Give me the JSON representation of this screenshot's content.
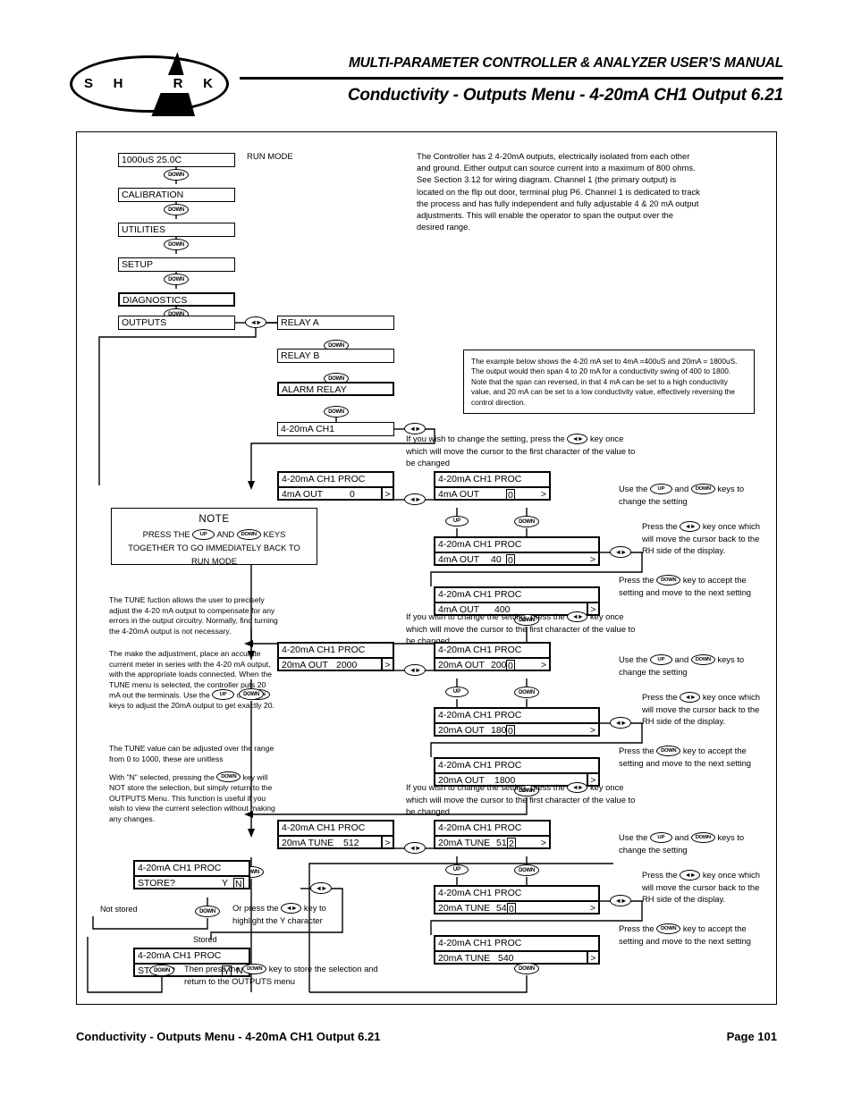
{
  "header": {
    "logo_text": "SHARK",
    "logo_letters": [
      "S",
      "H",
      "A",
      "R",
      "K"
    ],
    "title_line1": "MULTI-PARAMETER CONTROLLER & ANALYZER USER’S MANUAL",
    "title_line2": "Conductivity - Outputs Menu - 4-20mA CH1 Output 6.21"
  },
  "footer": {
    "left": "Conductivity - Outputs Menu - 4-20mA CH1 Output 6.21",
    "right": "Page 101"
  },
  "keys": {
    "down": "DOWN",
    "up": "UP",
    "leftright": "◄►"
  },
  "run_mode_label": "RUN MODE",
  "main_menu": [
    {
      "label": "1000uS  25.0C"
    },
    {
      "label": "CALIBRATION"
    },
    {
      "label": "UTILITIES"
    },
    {
      "label": "SETUP"
    },
    {
      "label": "DIAGNOSTICS"
    },
    {
      "label": "OUTPUTS"
    }
  ],
  "outputs_submenu": [
    {
      "label": "RELAY A"
    },
    {
      "label": "RELAY B"
    },
    {
      "label": "ALARM RELAY"
    },
    {
      "label": "4-20mA CH1"
    }
  ],
  "intro_text": "The Controller has 2 4-20mA outputs, electrically isolated from each other and ground. Either output can source current into a maximum of 800 ohms. See Section 3.12 for wiring diagram. Channel 1 (the primary output) is located on the flip out door, terminal plug P6. Channel 1 is dedicated to track the process and has fully independent and fully adjustable 4 & 20 mA output adjustments. This will enable the operator to span the output over the desired range.",
  "example_box_text": "The example below shows the 4-20 mA set to 4mA =400uS and 20mA = 1800uS. The output would then span 4 to 20 mA for a conductivity swing of 400 to 1800. Note that the span can reversed, in that 4 mA can be set to a high conductivity value, and 20 mA can be set to a low conductivity value, effectively reversing the control direction.",
  "note_box": {
    "title": "NOTE",
    "line1_pre": "PRESS THE",
    "line1_mid": "AND",
    "line1_post": "KEYS",
    "line2": "TOGETHER TO GO IMMEDIATELY BACK TO",
    "line3": "RUN MODE"
  },
  "tune_text_1": "The TUNE fuction allows the user to precisely adjust the 4-20 mA output to compensate for any errors in the output circuitry. Normally, find turning the 4-20mA output is not necessary.",
  "tune_text_2a": "The make the adjustment, place an accurate current meter in series with the 4-20 mA output, with the appropriate loads connected.  When the TUNE menu is selected, the controller puts 20 mA out the terminals. Use the",
  "tune_text_2b": "or",
  "tune_text_2c": "keys to adjust the 20mA output to get exactly 20.",
  "tune_text_3": "The TUNE value can be adjusted over the range from 0 to 1000, these are unitless",
  "tune_text_4a": "With \"N\" selected, pressing the",
  "tune_text_4b": "key will NOT store the selection, but simply return to the OUTPUTS Menu. This function is useful if you wish to view the current selection without making any changes.",
  "instr_change_a": "If you wish to change the setting, press the",
  "instr_change_b": "key once which will move the cursor to the first character of the value to be changed",
  "instr_use_a": "Use the",
  "instr_use_b": "and",
  "instr_use_c": "keys to change the setting",
  "instr_press_lr_a": "Press the",
  "instr_press_lr_b": "key once which will move the cursor back to the RH side of the display.",
  "instr_accept_a": "Press the",
  "instr_accept_b": "key to accept the setting and move to the next setting",
  "sequences": [
    {
      "id": "4ma-out",
      "title": "4-20mA CH1 PROC",
      "field": "4mA OUT",
      "left_value": "0",
      "steps": [
        {
          "prefix": "",
          "highlight": "0",
          "suffix": "",
          "style": "boxed"
        },
        {
          "prefix": "40",
          "highlight": "0",
          "suffix": "",
          "style": "boxed"
        },
        {
          "prefix": "400",
          "highlight": "",
          "suffix": "",
          "style": "plain"
        }
      ]
    },
    {
      "id": "20ma-out",
      "title": "4-20mA CH1 PROC",
      "field": "20mA OUT",
      "left_value": "2000",
      "steps": [
        {
          "prefix": "200",
          "highlight": "0",
          "suffix": "",
          "style": "boxed"
        },
        {
          "prefix": "180",
          "highlight": "0",
          "suffix": "",
          "style": "boxed"
        },
        {
          "prefix": "1800",
          "highlight": "",
          "suffix": "",
          "style": "plain"
        }
      ]
    },
    {
      "id": "20ma-tune",
      "title": "4-20mA CH1 PROC",
      "field": "20mA  TUNE",
      "left_value": "512",
      "steps": [
        {
          "prefix": "51",
          "highlight": "2",
          "suffix": "",
          "style": "boxed"
        },
        {
          "prefix": "54",
          "highlight": "0",
          "suffix": "",
          "style": "boxed"
        },
        {
          "prefix": "540",
          "highlight": "",
          "suffix": "",
          "style": "plain"
        }
      ]
    }
  ],
  "store": {
    "title": "4-20mA CH1 PROC",
    "field": "STORE?",
    "no_selected": {
      "y": "Y",
      "n": "N"
    },
    "yes_selected": {
      "y": "Y",
      "n": "N"
    },
    "not_stored_label": "Not stored",
    "stored_label": "Stored",
    "or_press_a": "Or press the",
    "or_press_b": "key to highlight the Y character",
    "then_press_a": "Then press the",
    "then_press_b": "key to store the selection and return to the OUTPUTS menu"
  },
  "colors": {
    "ink": "#000000",
    "paper": "#ffffff"
  }
}
